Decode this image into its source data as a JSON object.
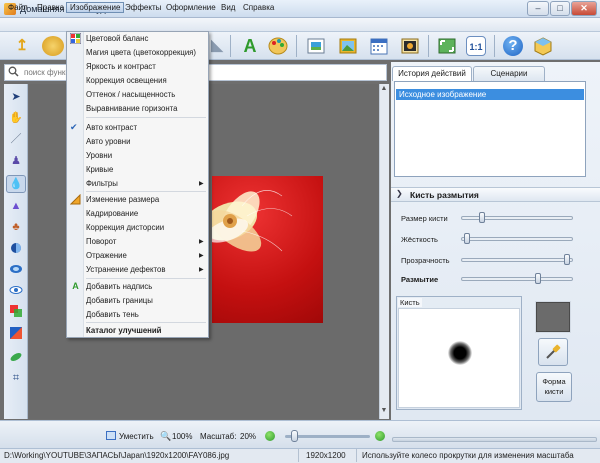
{
  "window": {
    "title": "Домашняя Фотостудия",
    "minimize": "–",
    "maximize": "□",
    "close": "✕"
  },
  "menubar": [
    "Файл",
    "Правка",
    "Изображение",
    "Эффекты",
    "Оформление",
    "Вид",
    "Справка"
  ],
  "search": {
    "placeholder": "поиск функции"
  },
  "dropdown": {
    "items": [
      {
        "label": "Цветовой баланс",
        "icon": "color-balance-icon"
      },
      {
        "label": "Магия цвета (цветокоррекция)"
      },
      {
        "label": "Яркость и контраст"
      },
      {
        "label": "Коррекция освещения"
      },
      {
        "label": "Оттенок / насыщенность"
      },
      {
        "label": "Выравнивание горизонта"
      },
      {
        "label": "Авто контраст",
        "checked": true
      },
      {
        "label": "Авто уровни"
      },
      {
        "label": "Уровни"
      },
      {
        "label": "Кривые"
      },
      {
        "label": "Фильтры",
        "submenu": true
      },
      {
        "label": "Изменение размера",
        "icon": "resize-icon"
      },
      {
        "label": "Кадрирование"
      },
      {
        "label": "Коррекция дисторсии"
      },
      {
        "label": "Поворот",
        "submenu": true
      },
      {
        "label": "Отражение",
        "submenu": true
      },
      {
        "label": "Устранение дефектов",
        "submenu": true
      },
      {
        "label": "Добавить надпись",
        "icon": "text-a-icon"
      },
      {
        "label": "Добавить границы"
      },
      {
        "label": "Добавить тень"
      },
      {
        "label": "Каталог улучшений",
        "bold": true
      }
    ]
  },
  "right_panel": {
    "tabs": [
      "История действий",
      "Сценарии"
    ],
    "history": [
      "Исходное изображение"
    ],
    "brush_panel": {
      "title": "Кисть размытия",
      "sliders": [
        {
          "label": "Размер кисти",
          "value": 0.17
        },
        {
          "label": "Жёсткость",
          "value": 0.03
        },
        {
          "label": "Прозрачность",
          "value": 0.97
        },
        {
          "label": "Размытие",
          "value": 0.7,
          "bold": true
        }
      ],
      "brush_label": "Кисть",
      "shape_button": "Форма кисти"
    }
  },
  "zoombar": {
    "fit_label": "Уместить",
    "actual_label": "100%",
    "scale_label": "Масштаб:",
    "scale_value": "20%",
    "zoom_slider": 0.08
  },
  "status": {
    "path": "D:\\Working\\YOUTUBE\\ЗАПАСЫ\\Japan\\1920x1200\\FAY086.jpg",
    "size": "1920x1200",
    "hint": "Используйте колесо прокрутки для изменения масштаба"
  }
}
